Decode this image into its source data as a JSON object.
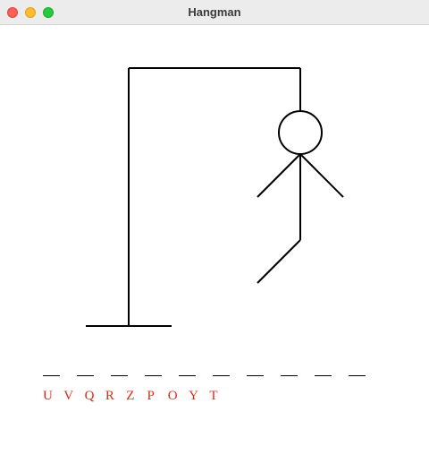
{
  "window": {
    "title": "Hangman"
  },
  "game": {
    "word_length": 10,
    "word_slots": [
      "",
      "",
      "",
      "",
      "",
      "",
      "",
      "",
      "",
      ""
    ],
    "wrong_guesses": [
      "U",
      "V",
      "Q",
      "R",
      "Z",
      "P",
      "O",
      "Y",
      "T"
    ],
    "wrong_guess_color": "#d52b1e",
    "parts_drawn": [
      "head",
      "body",
      "left-arm",
      "right-arm",
      "left-leg"
    ]
  }
}
